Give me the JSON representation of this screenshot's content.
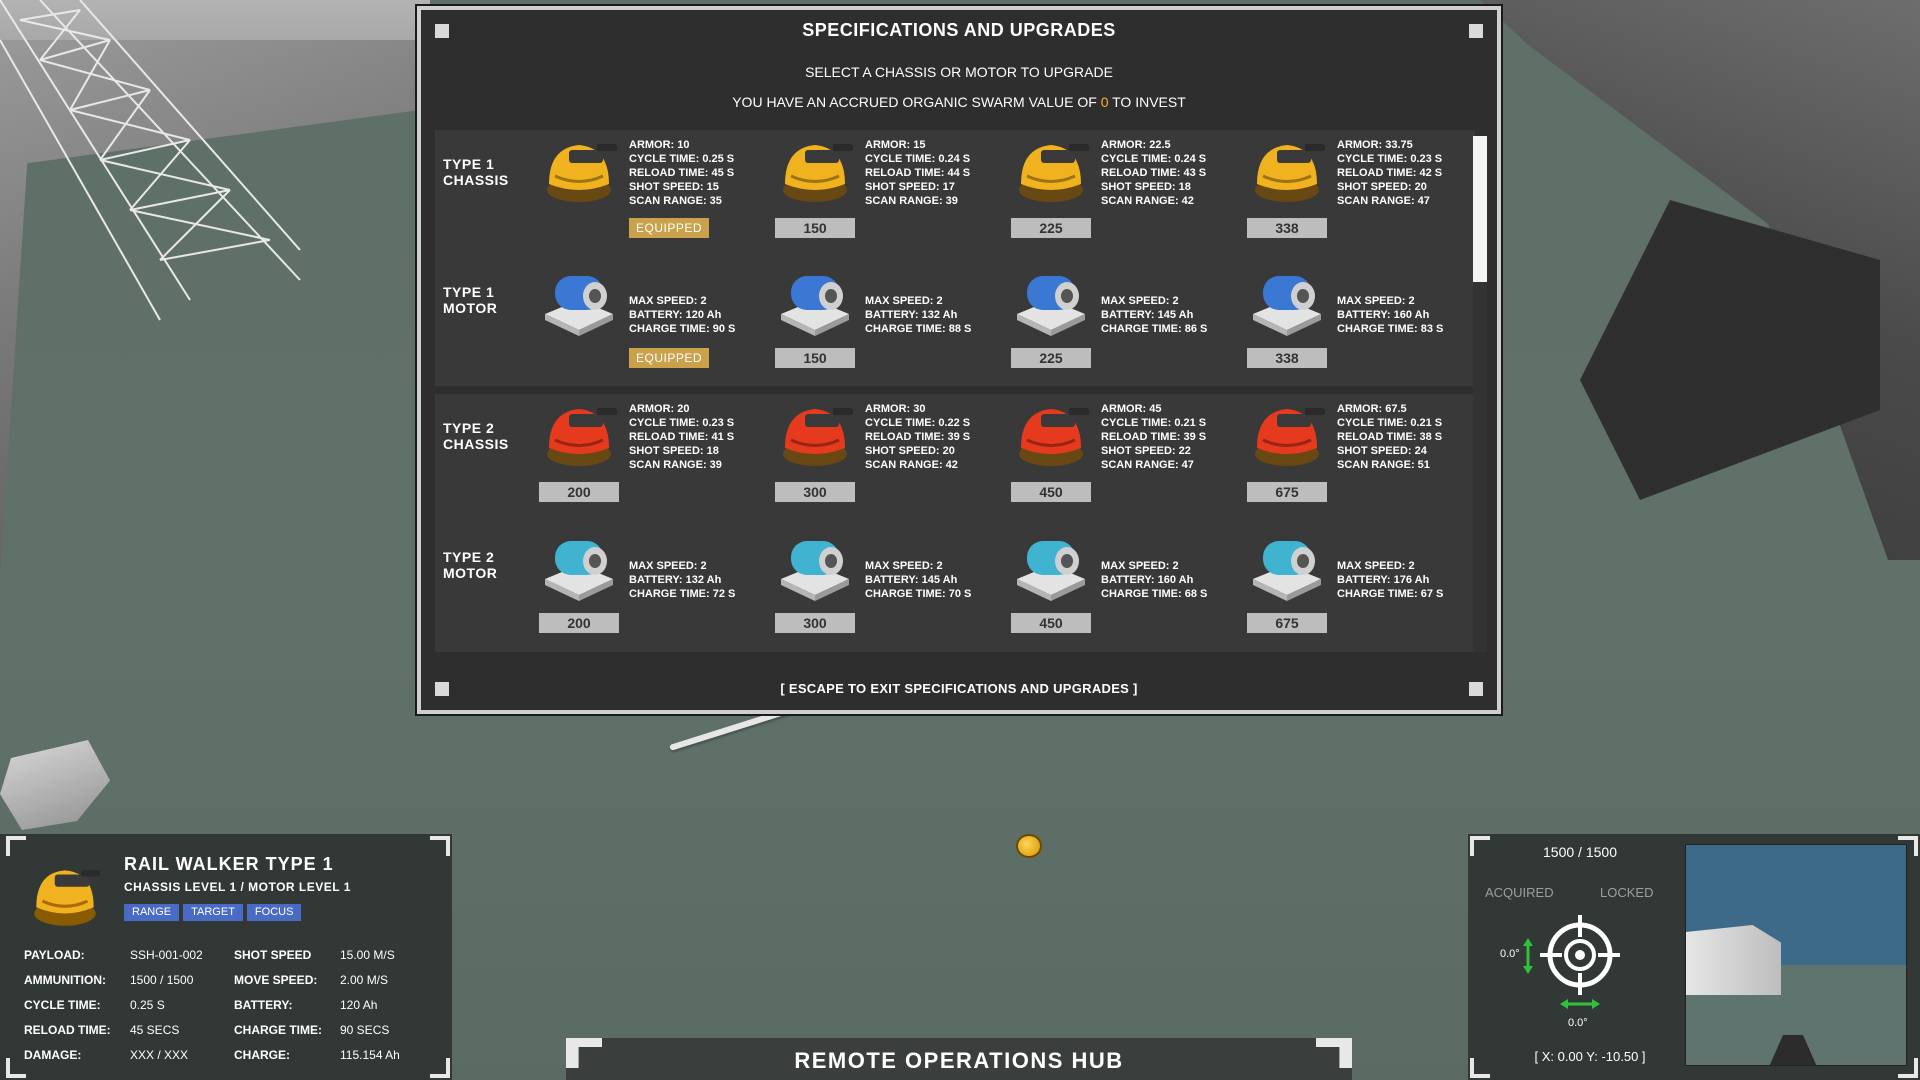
{
  "panel": {
    "title": "SPECIFICATIONS AND UPGRADES",
    "subtitle": "SELECT A CHASSIS OR MOTOR TO UPGRADE",
    "swarm_prefix": "YOU HAVE AN ACCRUED ORGANIC SWARM VALUE OF",
    "swarm_value": "0",
    "swarm_suffix": "TO INVEST",
    "footer": "[ ESCAPE TO EXIT SPECIFICATIONS AND UPGRADES ]",
    "rows": [
      {
        "label": "TYPE 1\nCHASSIS",
        "kind": "chassis",
        "color": "#f0b21e",
        "items": [
          {
            "stats": [
              "ARMOR: 10",
              "CYCLE TIME: 0.25 S",
              "RELOAD TIME: 45 S",
              "SHOT SPEED: 15",
              "SCAN RANGE: 35"
            ],
            "price": "EQUIPPED",
            "equipped": true
          },
          {
            "stats": [
              "ARMOR: 15",
              "CYCLE TIME: 0.24 S",
              "RELOAD TIME: 44 S",
              "SHOT SPEED: 17",
              "SCAN RANGE: 39"
            ],
            "price": "150",
            "equipped": false
          },
          {
            "stats": [
              "ARMOR: 22.5",
              "CYCLE TIME: 0.24 S",
              "RELOAD TIME: 43 S",
              "SHOT SPEED: 18",
              "SCAN RANGE: 42"
            ],
            "price": "225",
            "equipped": false
          },
          {
            "stats": [
              "ARMOR: 33.75",
              "CYCLE TIME: 0.23 S",
              "RELOAD TIME: 42 S",
              "SHOT SPEED: 20",
              "SCAN RANGE: 47"
            ],
            "price": "338",
            "equipped": false
          }
        ]
      },
      {
        "label": "TYPE 1\nMOTOR",
        "kind": "motor",
        "color": "#3a78d4",
        "items": [
          {
            "stats": [
              "MAX SPEED: 2",
              "BATTERY: 120 Ah",
              "CHARGE TIME: 90 S"
            ],
            "price": "EQUIPPED",
            "equipped": true
          },
          {
            "stats": [
              "MAX SPEED: 2",
              "BATTERY: 132 Ah",
              "CHARGE TIME: 88 S"
            ],
            "price": "150",
            "equipped": false
          },
          {
            "stats": [
              "MAX SPEED: 2",
              "BATTERY: 145 Ah",
              "CHARGE TIME: 86 S"
            ],
            "price": "225",
            "equipped": false
          },
          {
            "stats": [
              "MAX SPEED: 2",
              "BATTERY: 160 Ah",
              "CHARGE TIME: 83 S"
            ],
            "price": "338",
            "equipped": false
          }
        ]
      },
      {
        "label": "TYPE 2\nCHASSIS",
        "kind": "chassis",
        "color": "#e63a1e",
        "items": [
          {
            "stats": [
              "ARMOR: 20",
              "CYCLE TIME: 0.23 S",
              "RELOAD TIME: 41 S",
              "SHOT SPEED: 18",
              "SCAN RANGE: 39"
            ],
            "price": "200",
            "equipped": false
          },
          {
            "stats": [
              "ARMOR: 30",
              "CYCLE TIME: 0.22 S",
              "RELOAD TIME: 39 S",
              "SHOT SPEED: 20",
              "SCAN RANGE: 42"
            ],
            "price": "300",
            "equipped": false
          },
          {
            "stats": [
              "ARMOR: 45",
              "CYCLE TIME: 0.21 S",
              "RELOAD TIME: 39 S",
              "SHOT SPEED: 22",
              "SCAN RANGE: 47"
            ],
            "price": "450",
            "equipped": false
          },
          {
            "stats": [
              "ARMOR: 67.5",
              "CYCLE TIME: 0.21 S",
              "RELOAD TIME: 38 S",
              "SHOT SPEED: 24",
              "SCAN RANGE: 51"
            ],
            "price": "675",
            "equipped": false
          }
        ]
      },
      {
        "label": "TYPE 2\nMOTOR",
        "kind": "motor",
        "color": "#3fb3cf",
        "items": [
          {
            "stats": [
              "MAX SPEED: 2",
              "BATTERY: 132 Ah",
              "CHARGE TIME: 72 S"
            ],
            "price": "200",
            "equipped": false
          },
          {
            "stats": [
              "MAX SPEED: 2",
              "BATTERY: 145 Ah",
              "CHARGE TIME: 70 S"
            ],
            "price": "300",
            "equipped": false
          },
          {
            "stats": [
              "MAX SPEED: 2",
              "BATTERY: 160 Ah",
              "CHARGE TIME: 68 S"
            ],
            "price": "450",
            "equipped": false
          },
          {
            "stats": [
              "MAX SPEED: 2",
              "BATTERY: 176 Ah",
              "CHARGE TIME: 67 S"
            ],
            "price": "675",
            "equipped": false
          }
        ]
      }
    ]
  },
  "unit": {
    "name": "RAIL WALKER TYPE 1",
    "level": "CHASSIS LEVEL 1 / MOTOR LEVEL 1",
    "tags": [
      "RANGE",
      "TARGET",
      "FOCUS"
    ],
    "stats_left": [
      {
        "label": "PAYLOAD:",
        "value": "SSH-001-002"
      },
      {
        "label": "AMMUNITION:",
        "value": "1500 / 1500"
      },
      {
        "label": "CYCLE TIME:",
        "value": "0.25 S"
      },
      {
        "label": "RELOAD TIME:",
        "value": "45 SECS"
      },
      {
        "label": "DAMAGE:",
        "value": "XXX / XXX"
      }
    ],
    "stats_right": [
      {
        "label": "SHOT SPEED",
        "value": "15.00 M/S"
      },
      {
        "label": "MOVE SPEED:",
        "value": "2.00 M/S"
      },
      {
        "label": "BATTERY:",
        "value": "120 Ah"
      },
      {
        "label": "CHARGE TIME:",
        "value": "90 SECS"
      },
      {
        "label": "CHARGE:",
        "value": "115.154 Ah"
      }
    ]
  },
  "hub": {
    "title": "REMOTE OPERATIONS HUB"
  },
  "targeting": {
    "ammo": "1500 / 1500",
    "acquired": "ACQUIRED",
    "locked": "LOCKED",
    "pitch": "0.0°",
    "yaw": "0.0°",
    "coords": "[ X: 0.00  Y: -10.50 ]"
  },
  "colors": {
    "accent_gold": "#f0b429",
    "tag_blue": "#4a6bc4",
    "equipped_gold": "#c9a24b"
  }
}
